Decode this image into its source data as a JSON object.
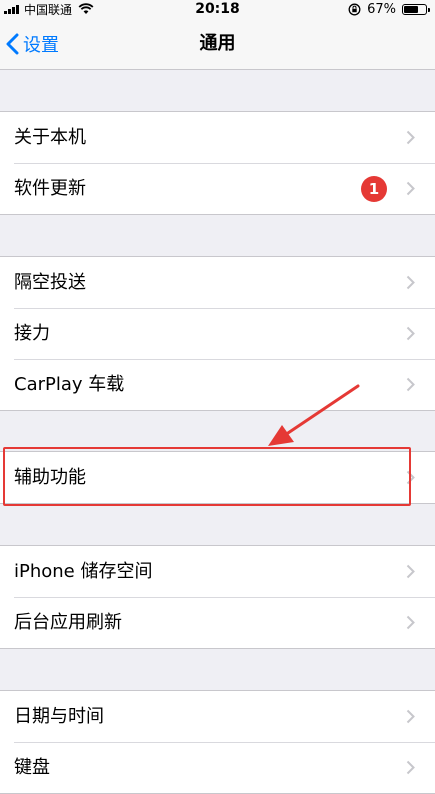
{
  "status_bar": {
    "carrier": "中国联通",
    "time": "20:18",
    "battery": "67%",
    "battery_level": 0.67,
    "icons": [
      "signal-icon",
      "wifi-icon",
      "orientation-lock-icon",
      "battery-icon"
    ]
  },
  "nav": {
    "back_label": "设置",
    "title": "通用",
    "accent_color": "#007aff"
  },
  "groups": [
    {
      "rows": [
        {
          "label": "关于本机"
        },
        {
          "label": "软件更新",
          "badge": "1"
        }
      ]
    },
    {
      "rows": [
        {
          "label": "隔空投送"
        },
        {
          "label": "接力"
        },
        {
          "label": "CarPlay 车载"
        }
      ]
    },
    {
      "rows": [
        {
          "label": "辅助功能"
        }
      ]
    },
    {
      "rows": [
        {
          "label": "iPhone 储存空间"
        },
        {
          "label": "后台应用刷新"
        }
      ]
    },
    {
      "rows": [
        {
          "label": "日期与时间"
        },
        {
          "label": "键盘"
        }
      ]
    }
  ],
  "annotation": {
    "highlight_color": "#e53935",
    "highlighted_item": "辅助功能"
  }
}
